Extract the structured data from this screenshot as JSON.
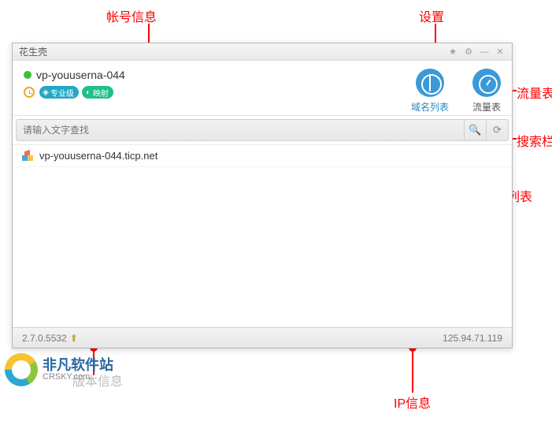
{
  "annotations": {
    "account_info": "帐号信息",
    "settings": "设置",
    "traffic": "流量表",
    "search": "搜索栏",
    "domain_list": "域名列表",
    "ip_info": "IP信息",
    "version_info": "版本信息"
  },
  "window": {
    "title": "花生壳",
    "account": {
      "name": "vp-youuserna-044",
      "online": true,
      "badges": {
        "pro": "专业级",
        "map": "映射"
      }
    },
    "nav": {
      "domain_list": "域名列表",
      "traffic": "流量表"
    },
    "search": {
      "placeholder": "请输入文字查找"
    },
    "domains": [
      {
        "host": "vp-youuserna-044.ticp.net"
      }
    ],
    "status": {
      "version": "2.7.0.5532",
      "ip": "125.94.71.119"
    }
  },
  "watermark": {
    "cn": "非凡软件站",
    "en": "CRSKY.com"
  }
}
